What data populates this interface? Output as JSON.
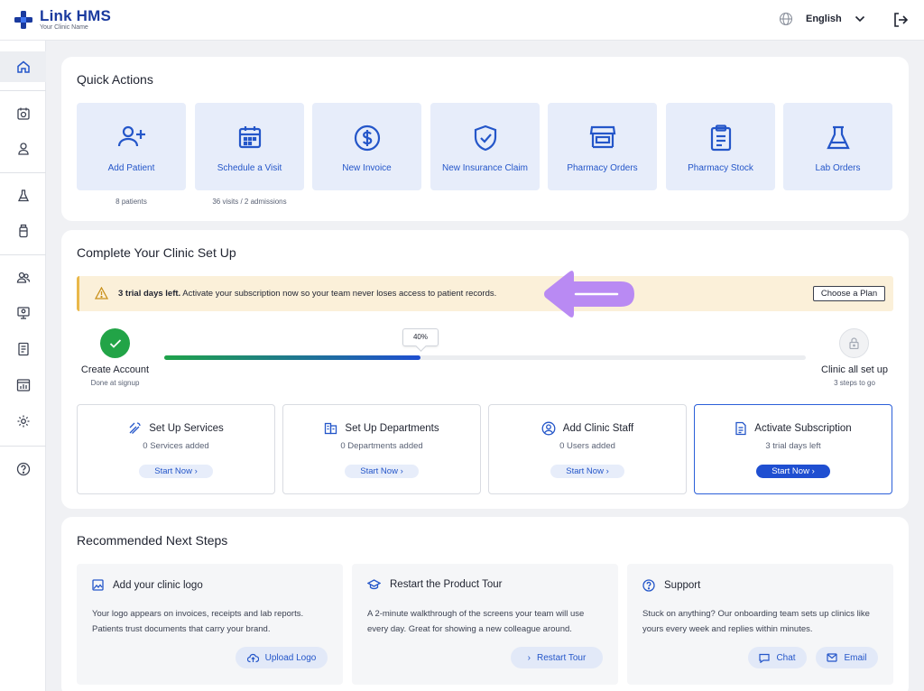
{
  "header": {
    "brand": "Link HMS",
    "subtitle": "Your Clinic Name",
    "language": "English"
  },
  "sidebar": {
    "items": [
      "home-icon",
      "calendar-icon",
      "user-icon",
      "flask-icon",
      "bottle-icon",
      "users-icon",
      "monitor-icon",
      "document-icon",
      "chart-icon",
      "gear-icon",
      "help-icon"
    ]
  },
  "quick_actions": {
    "title": "Quick Actions",
    "tiles": [
      {
        "label": "Add Patient",
        "count": "8 patients",
        "icon": "add-user-icon"
      },
      {
        "label": "Schedule a Visit",
        "count": "36 visits / 2 admissions",
        "icon": "calendar-icon"
      },
      {
        "label": "New Invoice",
        "count": "",
        "icon": "dollar-icon"
      },
      {
        "label": "New Insurance Claim",
        "count": "",
        "icon": "shield-check-icon"
      },
      {
        "label": "Pharmacy Orders",
        "count": "",
        "icon": "store-icon"
      },
      {
        "label": "Pharmacy Stock",
        "count": "",
        "icon": "clipboard-icon"
      },
      {
        "label": "Lab Orders",
        "count": "",
        "icon": "flask-icon"
      }
    ]
  },
  "setup": {
    "title": "Complete Your Clinic Set Up",
    "banner_bold": "3 trial days left.",
    "banner_text": " Activate your subscription now so your team never loses access to patient records.",
    "plan_button": "Choose a Plan",
    "progress_label": "40%",
    "progress": 0.4,
    "start_step": {
      "title": "Create Account",
      "sub": "Done at signup"
    },
    "end_step": {
      "title": "Clinic all set up",
      "sub": "3 steps to go"
    },
    "cards": [
      {
        "title": "Set Up Services",
        "sub": "0 Services added",
        "button": "Start Now",
        "icon": "tools-icon"
      },
      {
        "title": "Set Up Departments",
        "sub": "0 Departments added",
        "button": "Start Now",
        "icon": "building-icon"
      },
      {
        "title": "Add Clinic Staff",
        "sub": "0 Users added",
        "button": "Start Now",
        "icon": "user-circle-icon"
      },
      {
        "title": "Activate Subscription",
        "sub": "3 trial days left",
        "button": "Start Now",
        "icon": "receipt-icon"
      }
    ]
  },
  "next_steps": {
    "title": "Recommended Next Steps",
    "cards": [
      {
        "title": "Add your clinic logo",
        "body": "Your logo appears on invoices, receipts and lab reports. Patients trust documents that carry your brand.",
        "buttons": [
          "Upload Logo"
        ]
      },
      {
        "title": "Restart the Product Tour",
        "body": "A 2-minute walkthrough of the screens your team will use every day. Great for showing a new colleague around.",
        "buttons": [
          "Restart Tour"
        ]
      },
      {
        "title": "Support",
        "body": "Stuck on anything? Our onboarding team sets up clinics like yours every week and replies within minutes.",
        "buttons": [
          "Chat",
          "Email"
        ]
      }
    ]
  },
  "colors": {
    "brand": "#1a3a9e",
    "accent": "#2456c9",
    "success": "#22a447",
    "warning_bg": "#fbf0d9",
    "annotation": "#b98af3"
  }
}
